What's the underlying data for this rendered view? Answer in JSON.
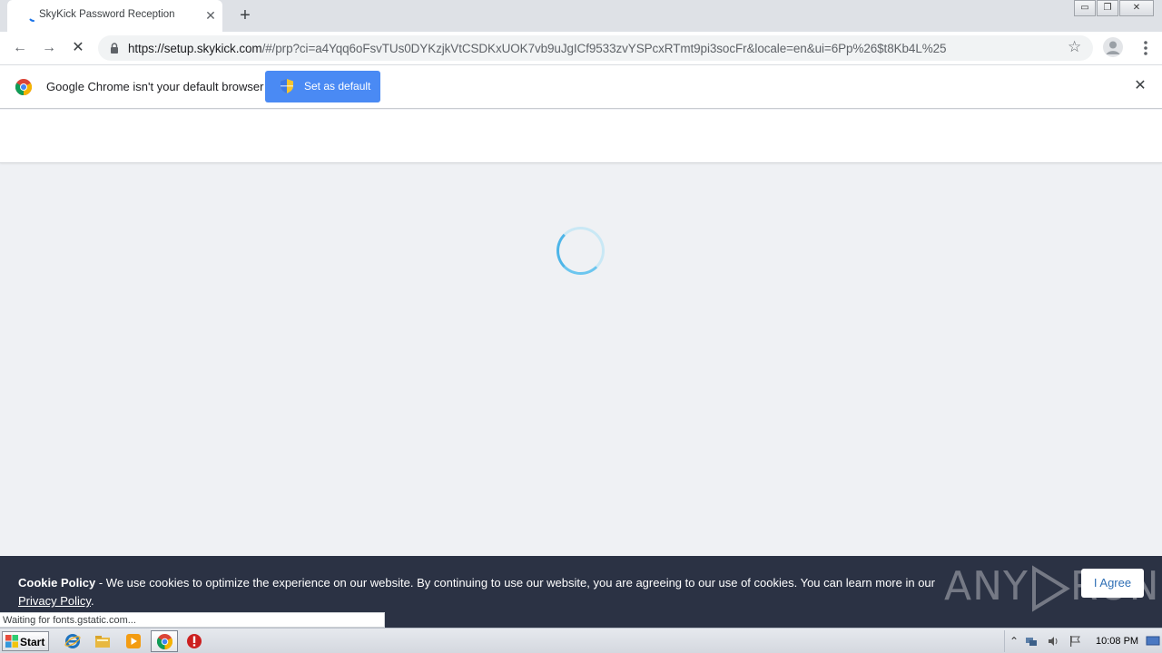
{
  "tab": {
    "title": "SkyKick Password Reception",
    "close": "✕"
  },
  "newtab": "+",
  "window_controls": {
    "minimize": "▭",
    "restore": "❐",
    "close": "✕"
  },
  "toolbar": {
    "url_host": "https://setup.skykick.com",
    "url_rest": "/#/prp?ci=a4Yqq6oFsvTUs0DYKzjkVtCSDKxUOK7vb9uJgICf9533zvYSPcxRTmt9pi3socFr&locale=en&ui=6Pp%26$t8Kb4L%25",
    "back": "←",
    "forward": "→",
    "stop": "✕",
    "star": "☆"
  },
  "infobar": {
    "message": "Google Chrome isn't your default browser",
    "button": "Set as default",
    "close": "✕"
  },
  "cookie": {
    "bold": "Cookie Policy",
    "text": " - We use cookies to optimize the experience on our website. By continuing to use our website, you are agreeing to our use of cookies. You can learn more in our ",
    "link": "Privacy Policy",
    "end": ".",
    "agree": "I Agree"
  },
  "watermark": {
    "left": "ANY",
    "right": "RUN"
  },
  "status": "Waiting for fonts.gstatic.com...",
  "taskbar": {
    "start": "Start",
    "clock": "10:08 PM"
  },
  "colors": {
    "accent": "#4a8af4",
    "cookie_bg": "#2b3244",
    "spinner": "#4db5e8"
  }
}
